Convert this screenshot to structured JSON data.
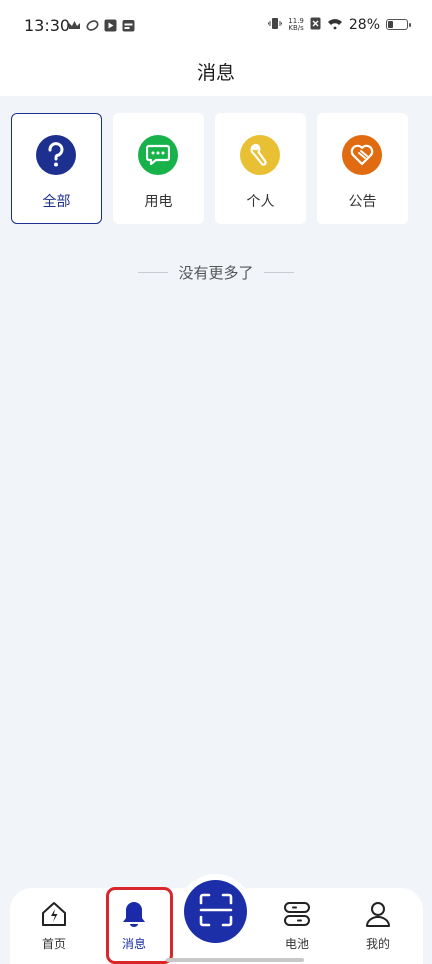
{
  "status_bar": {
    "time": "13:30",
    "net_speed_value": "11.9",
    "net_speed_unit": "KB/s",
    "battery_percent": "28%",
    "battery_level": 0.28,
    "icons_left": [
      "crown-icon",
      "app-icon",
      "play-icon",
      "calendar-icon"
    ],
    "icons_right": [
      "vibrate-icon",
      "no-sim-icon",
      "wifi-icon",
      "battery-icon"
    ]
  },
  "header": {
    "title": "消息"
  },
  "categories": [
    {
      "label": "全部",
      "icon": "question-icon",
      "color": "#1d2f8f",
      "active": true
    },
    {
      "label": "用电",
      "icon": "message-icon",
      "color": "#17b34a",
      "active": false
    },
    {
      "label": "个人",
      "icon": "wrench-icon",
      "color": "#e9c034",
      "active": false
    },
    {
      "label": "公告",
      "icon": "heart-hand-icon",
      "color": "#e16b10",
      "active": false
    }
  ],
  "empty_message": "没有更多了",
  "bottom_nav": {
    "items": [
      {
        "label": "首页",
        "icon": "home-icon",
        "active": false
      },
      {
        "label": "消息",
        "icon": "bell-icon",
        "active": true
      },
      {
        "label": "电池",
        "icon": "battery-pack-icon",
        "active": false
      },
      {
        "label": "我的",
        "icon": "user-icon",
        "active": false
      }
    ],
    "center_button_icon": "scan-icon"
  },
  "colors": {
    "brand": "#1c2fa9",
    "highlight": "#d9262a",
    "background": "#f1f5fa"
  }
}
